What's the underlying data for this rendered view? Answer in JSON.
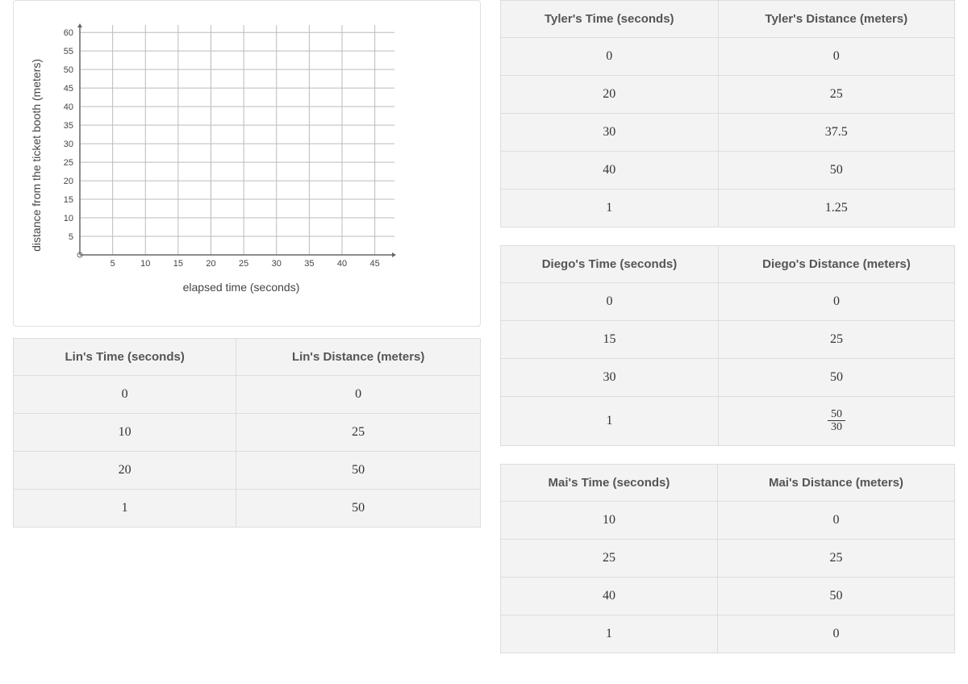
{
  "chart_data": {
    "type": "scatter",
    "title": "",
    "xlabel": "elapsed time (seconds)",
    "ylabel": "distance from the ticket booth (meters)",
    "xlim": [
      0,
      48
    ],
    "ylim": [
      0,
      62
    ],
    "xticks": [
      5,
      10,
      15,
      20,
      25,
      30,
      35,
      40,
      45
    ],
    "yticks": [
      5,
      10,
      15,
      20,
      25,
      30,
      35,
      40,
      45,
      50,
      55,
      60
    ],
    "series": []
  },
  "tables": {
    "lin": {
      "headers": [
        "Lin's Time (seconds)",
        "Lin's Distance (meters)"
      ],
      "rows": [
        [
          "0",
          "0"
        ],
        [
          "10",
          "25"
        ],
        [
          "20",
          "50"
        ],
        [
          "1",
          "50"
        ]
      ]
    },
    "tyler": {
      "headers": [
        "Tyler's Time (seconds)",
        "Tyler's Distance (meters)"
      ],
      "rows": [
        [
          "0",
          "0"
        ],
        [
          "20",
          "25"
        ],
        [
          "30",
          "37.5"
        ],
        [
          "40",
          "50"
        ],
        [
          "1",
          "1.25"
        ]
      ]
    },
    "diego": {
      "headers": [
        "Diego's Time (seconds)",
        "Diego's Distance (meters)"
      ],
      "rows": [
        [
          "0",
          "0"
        ],
        [
          "15",
          "25"
        ],
        [
          "30",
          "50"
        ],
        [
          "1",
          {
            "frac": [
              "50",
              "30"
            ]
          }
        ]
      ]
    },
    "mai": {
      "headers": [
        "Mai's Time (seconds)",
        "Mai's Distance (meters)"
      ],
      "rows": [
        [
          "10",
          "0"
        ],
        [
          "25",
          "25"
        ],
        [
          "40",
          "50"
        ],
        [
          "1",
          "0"
        ]
      ]
    }
  }
}
